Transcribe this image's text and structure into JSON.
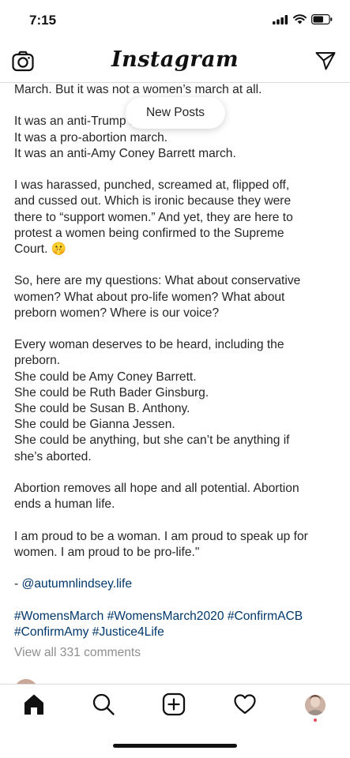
{
  "status": {
    "time": "7:15"
  },
  "header": {
    "title": "Instagram"
  },
  "new_posts_label": "New Posts",
  "caption": {
    "lines": [
      "March. But it was not a women’s march at all.",
      "",
      "It was an anti-Trump march.",
      "It was a pro-abortion march.",
      "It was an anti-Amy Coney Barrett march.",
      "",
      "I was harassed, punched, screamed at, flipped off,",
      "and cussed out. Which is ironic because they were",
      "there to “support women.” And yet, they are here to",
      "protest a women being confirmed to the Supreme",
      "Court. 🤫",
      "",
      "So, here are my questions: What about conservative",
      "women? What about pro-life women? What about",
      "preborn women? Where is our voice?",
      "",
      "Every woman deserves to be heard, including the",
      "preborn.",
      "She could be Amy Coney Barrett.",
      "She could be Ruth Bader Ginsburg.",
      "She could be Susan B. Anthony.",
      "She could be Gianna Jessen.",
      "She could be anything, but she can’t be anything if",
      "she’s aborted.",
      "",
      "Abortion removes all hope and all potential. Abortion",
      "ends a human life.",
      "",
      "I am proud to be a woman. I am proud to speak up for",
      "women. I am proud to be pro-life.\""
    ],
    "credit_prefix": "- ",
    "credit_handle": "@autumnlindsey.life",
    "hashtags_line1": "#WomensMarch #WomensMarch2020 #ConfirmACB",
    "hashtags_line2": "#ConfirmAmy #Justice4Life"
  },
  "view_comments": "View all 331 comments",
  "icons": {
    "camera": "camera-icon",
    "send": "direct-message-icon",
    "home": "home-icon",
    "search": "search-icon",
    "new_post": "add-post-icon",
    "activity": "heart-icon",
    "profile": "profile-avatar"
  },
  "colors": {
    "link": "#00376b",
    "text": "#262626",
    "muted": "#8e8e8e",
    "notification_dot": "#ed4956"
  }
}
